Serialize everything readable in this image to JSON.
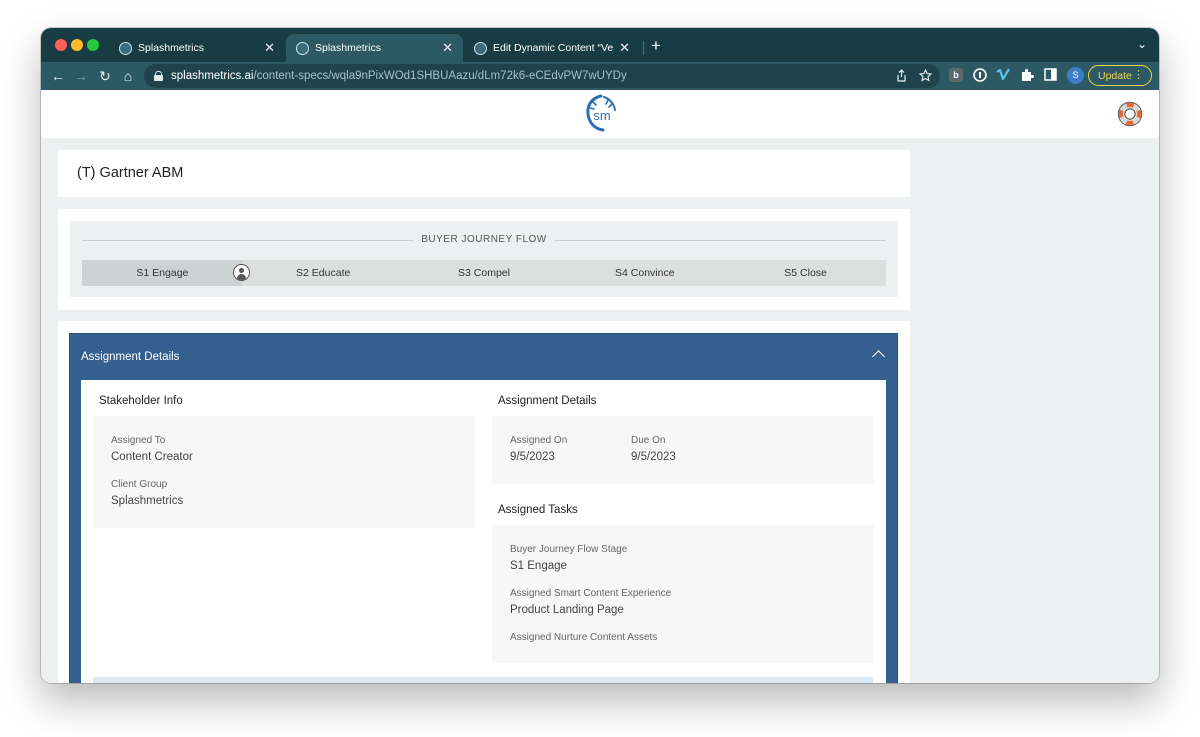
{
  "browser": {
    "tabs": [
      {
        "title": "Splashmetrics",
        "close": "✕"
      },
      {
        "title": "Splashmetrics",
        "close": "✕"
      },
      {
        "title": "Edit Dynamic Content “Version",
        "close": "✕"
      }
    ],
    "new_tab": "+",
    "tab_menu": "⌄",
    "url_host": "splashmetrics.ai",
    "url_path": "/content-specs/wqla9nPixWOd1SHBUAazu/dLm72k6-eCEdvPW7wUYDy",
    "profile_initial": "S",
    "update_label": "Update",
    "update_menu": "⋮",
    "nav": {
      "back": "←",
      "forward": "→",
      "reload": "↻",
      "home": "⌂"
    }
  },
  "site": {
    "logo_text": "sm"
  },
  "page": {
    "title": "(T) Gartner ABM"
  },
  "journey": {
    "label": "BUYER JOURNEY FLOW",
    "stages": [
      "S1 Engage",
      "S2 Educate",
      "S3 Compel",
      "S4 Convince",
      "S5 Close"
    ],
    "active_index": 0
  },
  "assignment": {
    "header": "Assignment Details",
    "stakeholder": {
      "title": "Stakeholder Info",
      "assigned_to_label": "Assigned To",
      "assigned_to_value": "Content Creator",
      "client_group_label": "Client Group",
      "client_group_value": "Splashmetrics"
    },
    "details": {
      "title": "Assignment Details",
      "assigned_on_label": "Assigned On",
      "assigned_on_value": "9/5/2023",
      "due_on_label": "Due On",
      "due_on_value": "9/5/2023"
    },
    "tasks": {
      "title": "Assigned Tasks",
      "stage_label": "Buyer Journey Flow Stage",
      "stage_value": "S1 Engage",
      "experience_label": "Assigned Smart Content Experience",
      "experience_value": "Product Landing Page",
      "nurture_label": "Assigned Nurture Content Assets"
    }
  },
  "colors": {
    "chrome_tabstrip": "#183c44",
    "chrome_toolbar": "#2c5963",
    "panel_blue": "#345f8f",
    "page_bg": "#edf0f0",
    "update_yellow": "#f0d44c"
  }
}
